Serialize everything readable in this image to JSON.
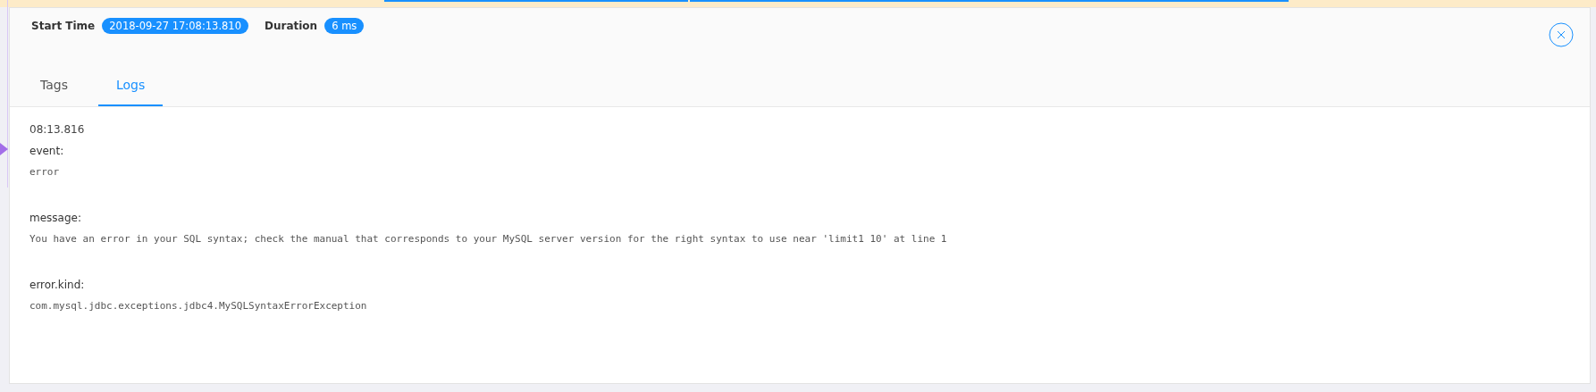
{
  "header": {
    "start_time_label": "Start Time",
    "start_time": "2018-09-27 17:08:13.810",
    "duration_label": "Duration",
    "duration": "6 ms"
  },
  "tabs": [
    {
      "label": "Tags",
      "selected": false
    },
    {
      "label": "Logs",
      "selected": true
    }
  ],
  "log": {
    "time": "08:13.816",
    "fields": [
      {
        "key": "event:",
        "value": "error"
      },
      {
        "key": "message:",
        "value": "You have an error in your SQL syntax; check the manual that corresponds to your MySQL server version for the right syntax to use near 'limit1 10' at line 1"
      },
      {
        "key": "error.kind:",
        "value": "com.mysql.jdbc.exceptions.jdbc4.MySQLSyntaxErrorException"
      }
    ]
  }
}
